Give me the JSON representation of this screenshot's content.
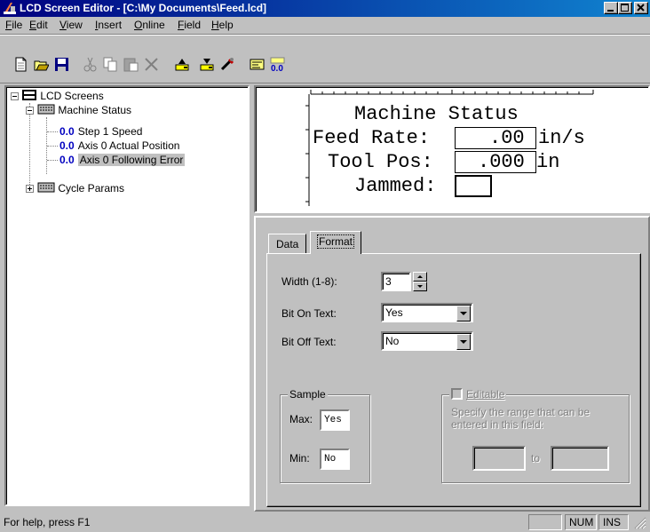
{
  "window": {
    "title": "LCD Screen Editor - [C:\\My Documents\\Feed.lcd]"
  },
  "menu": [
    "File",
    "Edit",
    "View",
    "Insert",
    "Online",
    "Field",
    "Help"
  ],
  "toolbar": {
    "buttons": [
      "new-icon",
      "open-icon",
      "save-icon",
      "cut-icon",
      "copy-icon",
      "paste-icon",
      "delete-icon",
      "upload-icon",
      "download-icon",
      "probe-icon",
      "lcd-screen-icon",
      "numeric-field-icon"
    ],
    "field_icon_text": "0.0"
  },
  "tree": {
    "root": "LCD Screens",
    "machine_status": "Machine Status",
    "num_icon": "0.0",
    "items": [
      "Step 1 Speed",
      "Axis 0 Actual Position",
      "Axis 0 Following Error"
    ],
    "cycle_params": "Cycle Params"
  },
  "lcd": {
    "line1": "Machine Status",
    "line2_label": "Feed Rate:",
    "line2_value": ".00",
    "line2_unit": "in/s",
    "line3_label": "Tool Pos:",
    "line3_value": ".000",
    "line3_unit": "in",
    "line4_label": "Jammed:"
  },
  "props": {
    "tabs": [
      "Data",
      "Format"
    ],
    "active_tab": "Format",
    "width_label": "Width (1-8):",
    "width_value": "3",
    "bit_on_label": "Bit On Text:",
    "bit_on_value": "Yes",
    "bit_off_label": "Bit Off Text:",
    "bit_off_value": "No",
    "sample": {
      "title": "Sample",
      "max_label": "Max:",
      "max_value": "Yes",
      "min_label": "Min:",
      "min_value": "No"
    },
    "editable": {
      "title": "Editable",
      "checked": false,
      "description": "Specify the range that can be entered in this field:",
      "to_label": "to"
    }
  },
  "status": {
    "help": "For help, press F1",
    "num": "NUM",
    "ins": "INS"
  }
}
